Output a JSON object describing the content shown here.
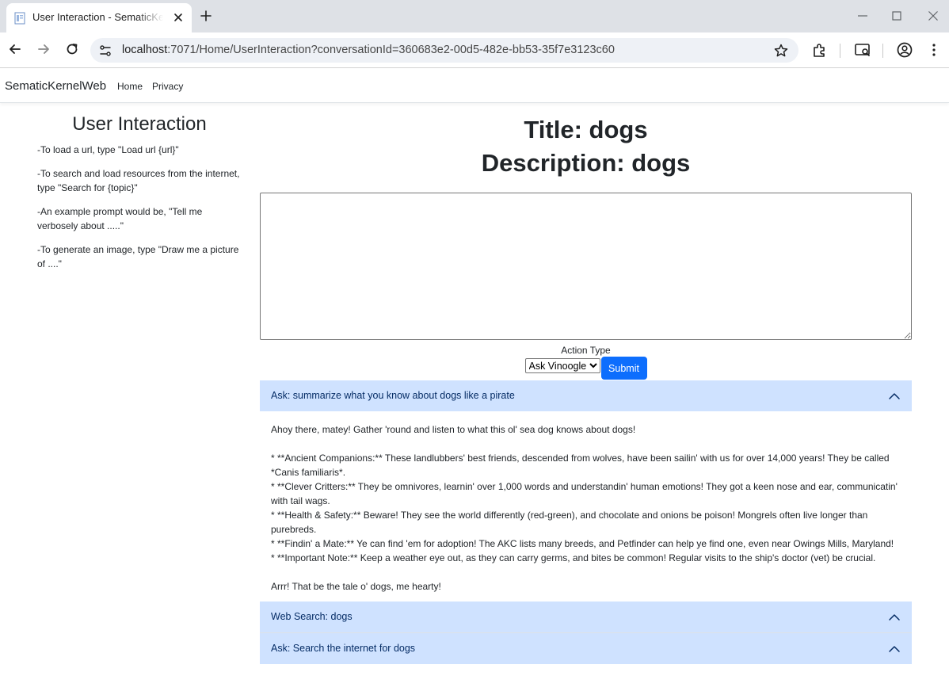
{
  "browser": {
    "tab_title": "User Interaction - SematicKernelWeb",
    "url_host": "localhost",
    "url_rest": ":7071/Home/UserInteraction?conversationId=360683e2-00d5-482e-bb53-35f7e3123c60"
  },
  "site": {
    "brand": "SematicKernelWeb",
    "nav": [
      "Home",
      "Privacy"
    ]
  },
  "sidebar": {
    "heading": "User Interaction",
    "tips": [
      "-To load a url, type \"Load url {url}\"",
      "-To search and load resources from the internet, type \"Search for {topic}\"",
      "-An example prompt would be, \"Tell me verbosely about .....\"",
      "-To generate an image, type \"Draw me a picture of ....\""
    ]
  },
  "main": {
    "title": "Title: dogs",
    "description": "Description: dogs",
    "prompt_value": "",
    "action_label": "Action Type",
    "action_selected": "Ask Vinoogle",
    "submit_label": "Submit"
  },
  "accordion": [
    {
      "header": "Ask: summarize what you know about dogs like a pirate",
      "expanded": true,
      "body": [
        "Ahoy there, matey! Gather 'round and listen to what this ol' sea dog knows about dogs!",
        "",
        "* **Ancient Companions:** These landlubbers' best friends, descended from wolves, have been sailin' with us for over 14,000 years! They be called *Canis familiaris*.",
        "* **Clever Critters:** They be omnivores, learnin' over 1,000 words and understandin' human emotions! They got a keen nose and ear, communicatin' with tail wags.",
        "* **Health & Safety:** Beware! They see the world differently (red-green), and chocolate and onions be poison! Mongrels often live longer than purebreds.",
        "* **Findin' a Mate:** Ye can find 'em for adoption! The AKC lists many breeds, and Petfinder can help ye find one, even near Owings Mills, Maryland!",
        "* **Important Note:** Keep a weather eye out, as they can carry germs, and bites be common! Regular visits to the ship's doctor (vet) be crucial.",
        "",
        "Arrr! That be the tale o' dogs, me hearty!"
      ]
    },
    {
      "header": "Web Search: dogs",
      "expanded": false
    },
    {
      "header": "Ask: Search the internet for dogs",
      "expanded": false
    }
  ],
  "colors": {
    "accent": "#0d6efd",
    "accordion_header_bg": "#cfe2ff",
    "accordion_header_text": "#052c65",
    "chrome_tabbar": "#dee1e6",
    "omnibox": "#eef1f6"
  },
  "icons": [
    "page-favicon",
    "close-icon",
    "plus-icon",
    "minimize-icon",
    "maximize-icon",
    "window-close-icon",
    "back-arrow-icon",
    "forward-arrow-icon",
    "reload-icon",
    "site-info-icon",
    "star-icon",
    "extensions-icon",
    "cast-search-icon",
    "profile-icon",
    "kebab-menu-icon",
    "chevron-up-icon"
  ]
}
